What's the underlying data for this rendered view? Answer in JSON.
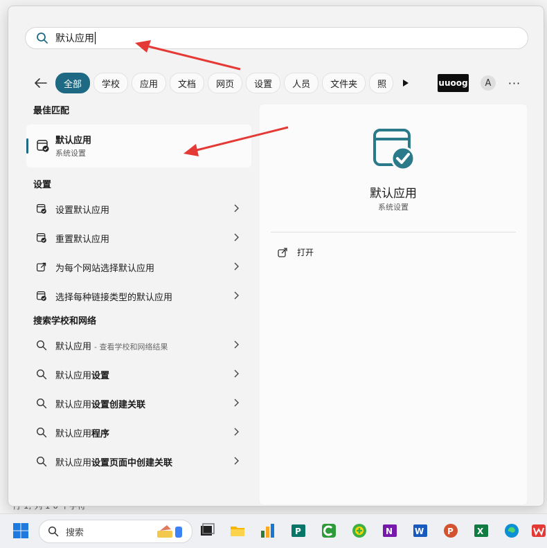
{
  "background_window": {
    "status_text": "行 1, 列 1    0 个字符"
  },
  "search": {
    "query": "默认应用"
  },
  "filters": {
    "back_icon": "arrow-left-icon",
    "chips": [
      "全部",
      "学校",
      "应用",
      "文档",
      "网页",
      "设置",
      "人员",
      "文件夹",
      "照"
    ],
    "active_chip": "全部",
    "more_arrow_icon": "play-triangle-icon",
    "profile_label": "uuoog",
    "avatar_letter": "A",
    "more_label": "···"
  },
  "left_pane": {
    "best_match_title": "最佳匹配",
    "best_match": {
      "name": "默认应用",
      "sub": "系统设置",
      "icon": "default-apps-icon"
    },
    "settings_title": "设置",
    "settings_items": [
      {
        "label": "设置默认应用",
        "icon": "default-apps-icon"
      },
      {
        "label": "重置默认应用",
        "icon": "default-apps-icon"
      },
      {
        "label": "为每个网站选择默认应用",
        "icon": "external-link-icon"
      },
      {
        "label": "选择每种链接类型的默认应用",
        "icon": "default-apps-icon"
      }
    ],
    "web_title": "搜索学校和网络",
    "web_items": [
      {
        "prefix": "默认应用",
        "bold": "",
        "hint": "- 查看学校和网络结果"
      },
      {
        "prefix": "默认应用",
        "bold": "设置",
        "hint": ""
      },
      {
        "prefix": "默认应用",
        "bold": "设置创建关联",
        "hint": ""
      },
      {
        "prefix": "默认应用",
        "bold": "程序",
        "hint": ""
      },
      {
        "prefix": "默认应用",
        "bold": "设置页面中创建关联",
        "hint": ""
      }
    ]
  },
  "right_pane": {
    "title": "默认应用",
    "subtitle": "系统设置",
    "open_label": "打开",
    "accent_color": "#2a7a8a"
  },
  "taskbar": {
    "search_placeholder": "搜索",
    "apps": [
      "windows-start-icon",
      "task-view-icon",
      "file-explorer-icon",
      "chart-app-icon",
      "publisher-icon",
      "camtasia-icon",
      "security-app-icon",
      "onenote-icon",
      "word-icon",
      "powerpoint-icon",
      "excel-icon",
      "edge-icon",
      "wps-icon"
    ]
  }
}
